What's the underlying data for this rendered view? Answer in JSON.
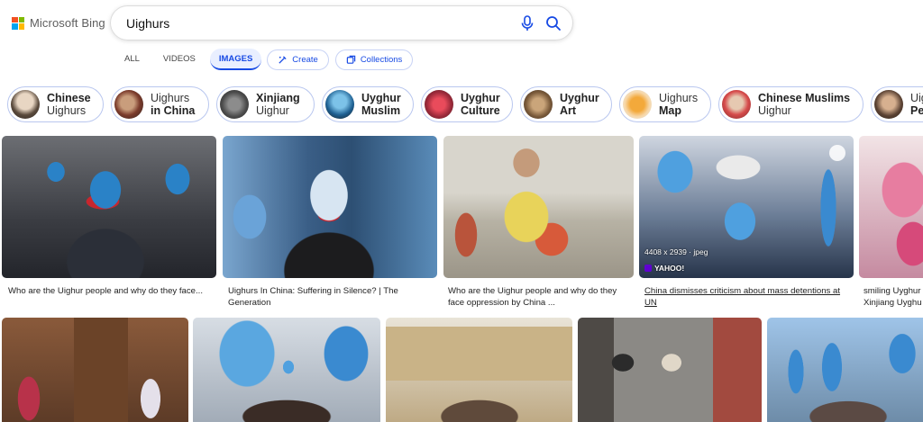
{
  "brand": {
    "name": "Microsoft Bing"
  },
  "search": {
    "query": "Uighurs"
  },
  "tabs": [
    {
      "label": "ALL"
    },
    {
      "label": "VIDEOS"
    },
    {
      "label": "IMAGES"
    }
  ],
  "actions": {
    "create": "Create",
    "collections": "Collections"
  },
  "related": [
    {
      "bold": "Chinese",
      "rest": "Uighurs",
      "boldFirst": true
    },
    {
      "bold": "in China",
      "rest": "Uighurs",
      "boldFirst": false
    },
    {
      "bold": "Xinjiang",
      "rest": "Uighur",
      "boldFirst": true
    },
    {
      "bold": "Uyghur",
      "rest": "Muslim",
      "boldFirst": true
    },
    {
      "bold": "Uyghur",
      "rest": "Culture",
      "boldFirst": true
    },
    {
      "bold": "Uyghur",
      "rest": "Art",
      "boldFirst": true
    },
    {
      "bold": "Map",
      "rest": "Uighurs",
      "boldFirst": false
    },
    {
      "bold": "Chinese Muslims",
      "rest": "Uighur",
      "boldFirst": true
    },
    {
      "bold": "Pe",
      "rest": "Uig",
      "boldFirst": false
    }
  ],
  "results": [
    {
      "caption": [
        "Who are the Uighur people and why do they face..."
      ]
    },
    {
      "caption": [
        "Uighurs In China: Suffering in Silence? | The",
        "Generation"
      ]
    },
    {
      "caption": [
        "Who are the Uighur people and why do they",
        "face oppression by China ..."
      ]
    },
    {
      "caption": [
        "China dismisses criticism about mass detentions at",
        "UN"
      ],
      "size": "4408 x 2939 · jpeg",
      "source": "YAHOO!"
    },
    {
      "caption": [
        "smiling Uyghur",
        "Xinjiang Uyghu"
      ]
    }
  ],
  "colors": {
    "accent": "#174ae4",
    "pill_border": "#b9c7ef"
  }
}
